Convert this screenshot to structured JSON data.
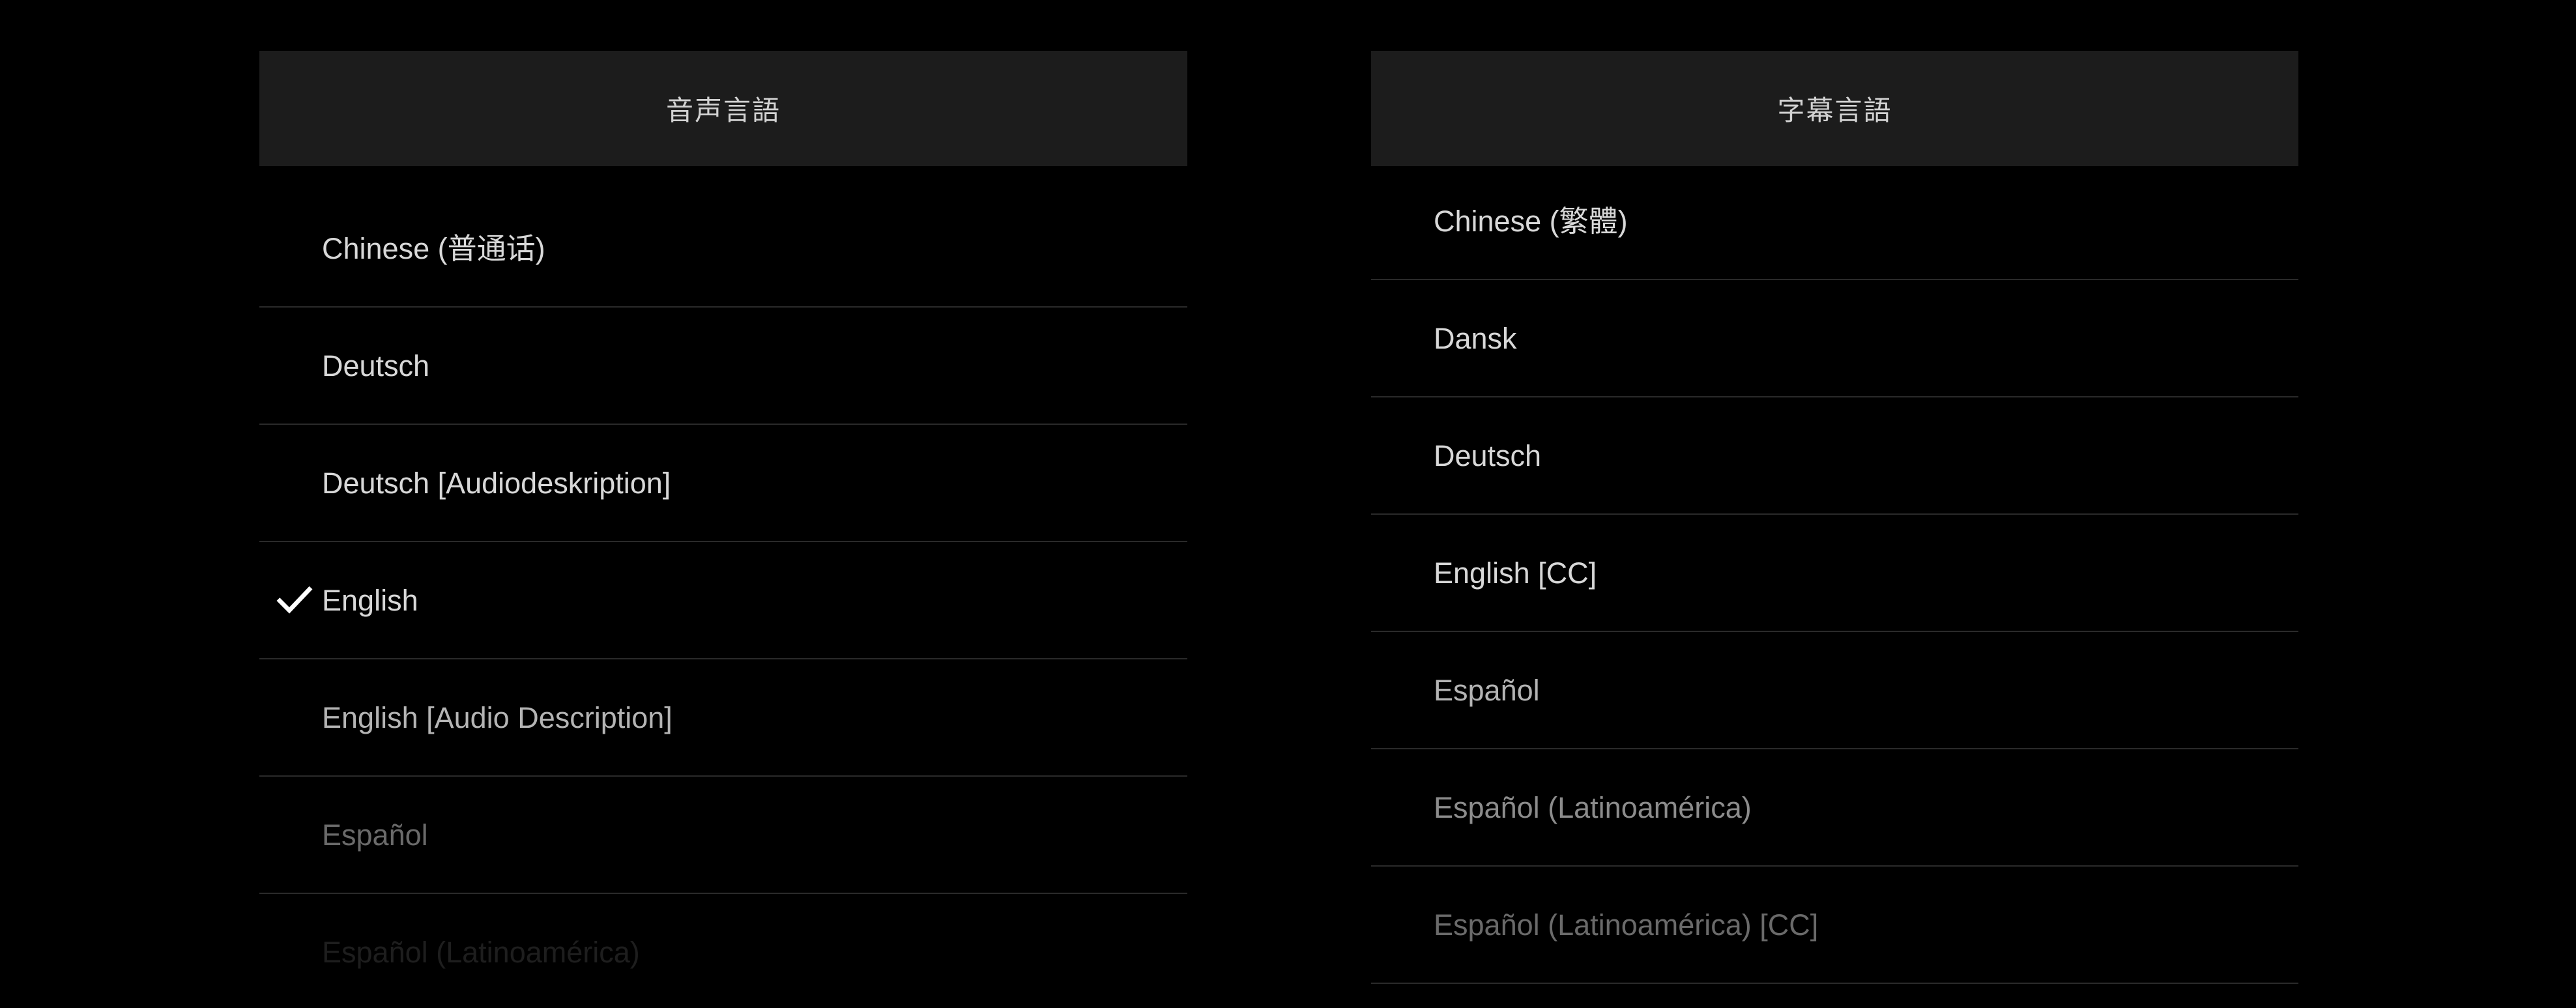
{
  "screen": {
    "background": "#000000",
    "panel_header_background": "#1c1c1c",
    "header_text_color": "#d2d2d2",
    "divider_color": "#2a2a2a",
    "selected_text_color": "#ffffff"
  },
  "panels": [
    {
      "id": "audio",
      "title": "音声言語",
      "options": [
        {
          "label": "Chinese (普通话)",
          "selected": false,
          "tier": "tier-full"
        },
        {
          "label": "Deutsch",
          "selected": false,
          "tier": "tier-full"
        },
        {
          "label": "Deutsch [Audiodeskription]",
          "selected": false,
          "tier": "tier-full"
        },
        {
          "label": "English",
          "selected": true,
          "tier": "tier-full",
          "check": "checkmark-icon"
        },
        {
          "label": "English [Audio Description]",
          "selected": false,
          "tier": "tier-dim1"
        },
        {
          "label": "Español",
          "selected": false,
          "tier": "tier-dim3"
        },
        {
          "label": "Español (Latinoamérica)",
          "selected": false,
          "tier": "tier-dim5"
        }
      ]
    },
    {
      "id": "subtitle",
      "title": "字幕言語",
      "options": [
        {
          "label": "Chinese (繁體)",
          "selected": false,
          "tier": "tier-full"
        },
        {
          "label": "Dansk",
          "selected": false,
          "tier": "tier-full"
        },
        {
          "label": "Deutsch",
          "selected": false,
          "tier": "tier-full"
        },
        {
          "label": "English [CC]",
          "selected": false,
          "tier": "tier-full"
        },
        {
          "label": "Español",
          "selected": false,
          "tier": "tier-dim1"
        },
        {
          "label": "Español (Latinoamérica)",
          "selected": false,
          "tier": "tier-dim2"
        },
        {
          "label": "Español (Latinoamérica) [CC]",
          "selected": false,
          "tier": "tier-dim3"
        }
      ]
    }
  ]
}
